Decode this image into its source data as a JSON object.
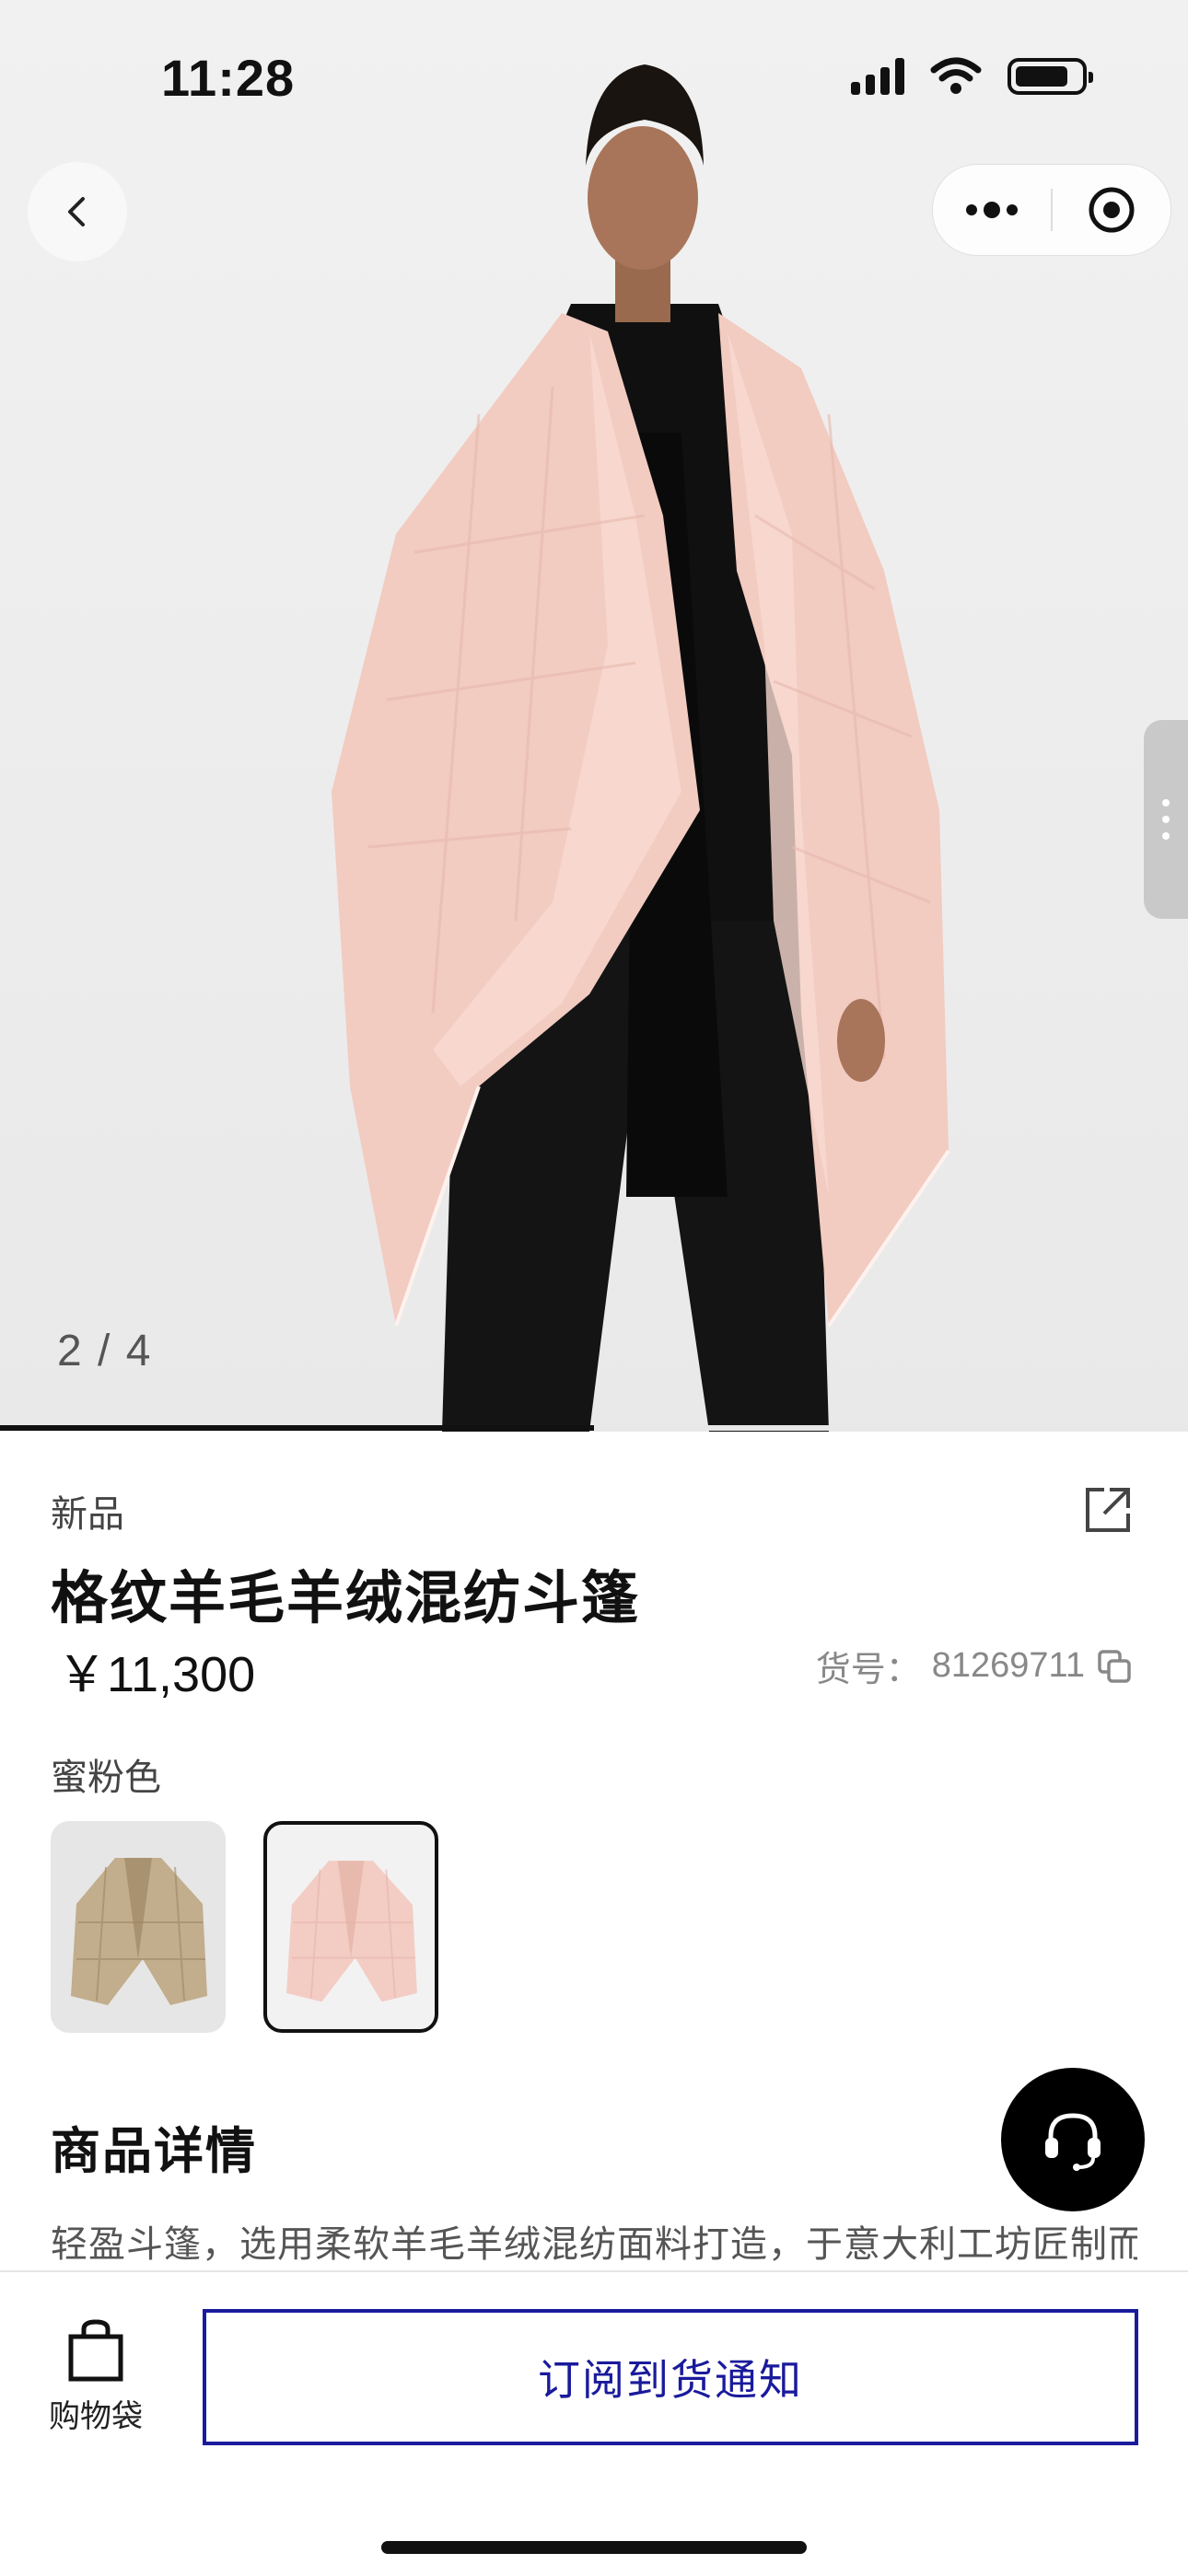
{
  "status_bar": {
    "time": "11:28"
  },
  "gallery": {
    "counter": "2 / 4",
    "current": 2,
    "total": 4,
    "progress": 0.5
  },
  "product": {
    "tag": "新品",
    "title": "格纹羊毛羊绒混纺斗篷",
    "price": "￥11,300",
    "sku_label": "货号：",
    "sku_value": "81269711",
    "color_name": "蜜粉色",
    "swatches": [
      {
        "name": "beige",
        "color": "#c2ad8c",
        "selected": false
      },
      {
        "name": "pink",
        "color": "#f3cdc4",
        "selected": true
      }
    ]
  },
  "details": {
    "title": "商品详情",
    "description": "轻盈斗篷，选用柔软羊毛羊绒混纺面料打造，于意大利工坊匠制而"
  },
  "bottom_bar": {
    "cart_label": "购物袋",
    "notify_label": "订阅到货通知"
  },
  "colors": {
    "accent": "#1a1a9c",
    "cape_pink": "#f3cdc4",
    "background": "#ececec"
  },
  "icons": {
    "back": "chevron-left-icon",
    "more": "more-dots-icon",
    "close_target": "target-icon",
    "share": "share-icon",
    "copy": "copy-icon",
    "customer_service": "headset-icon",
    "cart": "shopping-bag-icon"
  }
}
